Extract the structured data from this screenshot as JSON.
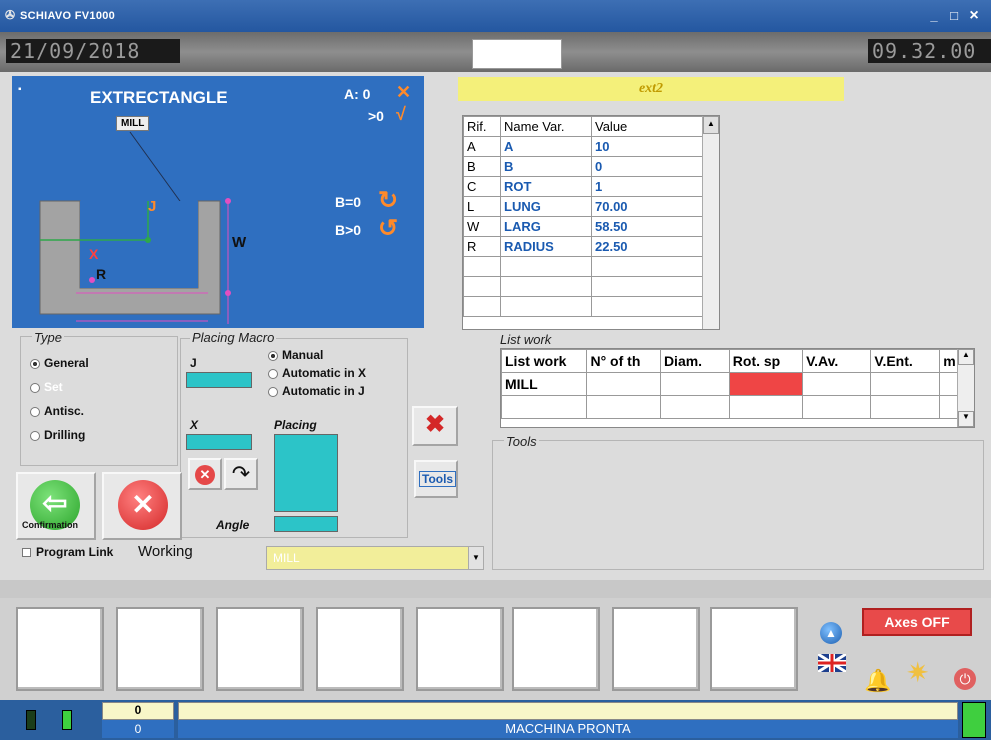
{
  "window": {
    "title": "SCHIAVO FV1000",
    "minimize": "_",
    "maximize": "□",
    "close": "×"
  },
  "clock": {
    "date": "21/09/2018",
    "time": "09.32.00"
  },
  "diagram": {
    "title": "EXTRECTANGLE",
    "mill_tag": "MILL",
    "a_label": "A: 0",
    "a_gt": ">0",
    "b_eq": "B=0",
    "b_gt": "B>0",
    "j": "J",
    "x": "X",
    "r": "R",
    "w": "W"
  },
  "program_name": "ext2",
  "variables": {
    "headers": [
      "Rif.",
      "Name Var.",
      "Value"
    ],
    "rows": [
      [
        "A",
        "A",
        "10"
      ],
      [
        "B",
        "B",
        "0"
      ],
      [
        "C",
        "ROT",
        "1"
      ],
      [
        "L",
        "LUNG",
        "70.00"
      ],
      [
        "W",
        "LARG",
        "58.50"
      ],
      [
        "R",
        "RADIUS",
        "22.50"
      ],
      [
        "",
        "",
        ""
      ],
      [
        "",
        "",
        ""
      ],
      [
        "",
        "",
        ""
      ]
    ]
  },
  "type_group": {
    "title": "Type",
    "options": [
      {
        "label": "General",
        "on": true
      },
      {
        "label": "Set",
        "on": false
      },
      {
        "label": "Antisc.",
        "on": false
      },
      {
        "label": "Drilling",
        "on": false
      }
    ]
  },
  "placing_macro": {
    "title": "Placing Macro",
    "j": "J",
    "x": "X",
    "placing": "Placing",
    "angle": "Angle",
    "options": [
      {
        "label": "Manual",
        "on": true
      },
      {
        "label": "Automatic in X",
        "on": false
      },
      {
        "label": "Automatic in J",
        "on": false
      }
    ]
  },
  "buttons": {
    "confirmation": "Confirmation",
    "tools": "Tools"
  },
  "list_work": {
    "title": "List work",
    "headers": [
      "List work",
      "N° of th",
      "Diam.",
      "Rot. sp",
      "V.Av.",
      "V.Ent.",
      "m"
    ],
    "rows": [
      [
        "MILL",
        "",
        "",
        "",
        "",
        "",
        ""
      ],
      [
        "",
        "",
        "",
        "",
        "",
        "",
        ""
      ]
    ]
  },
  "tools_title": "Tools",
  "program_link": {
    "label": "Program Link",
    "working": "Working",
    "select_value": "MILL"
  },
  "axes": "Axes OFF",
  "status": {
    "count1": "0",
    "count2": "0",
    "message": "MACCHINA PRONTA"
  },
  "colors": {
    "accent": "#2f6fc0",
    "highlight": "#f4f07a",
    "cyan": "#2cc4c8",
    "danger": "#ef4545"
  }
}
